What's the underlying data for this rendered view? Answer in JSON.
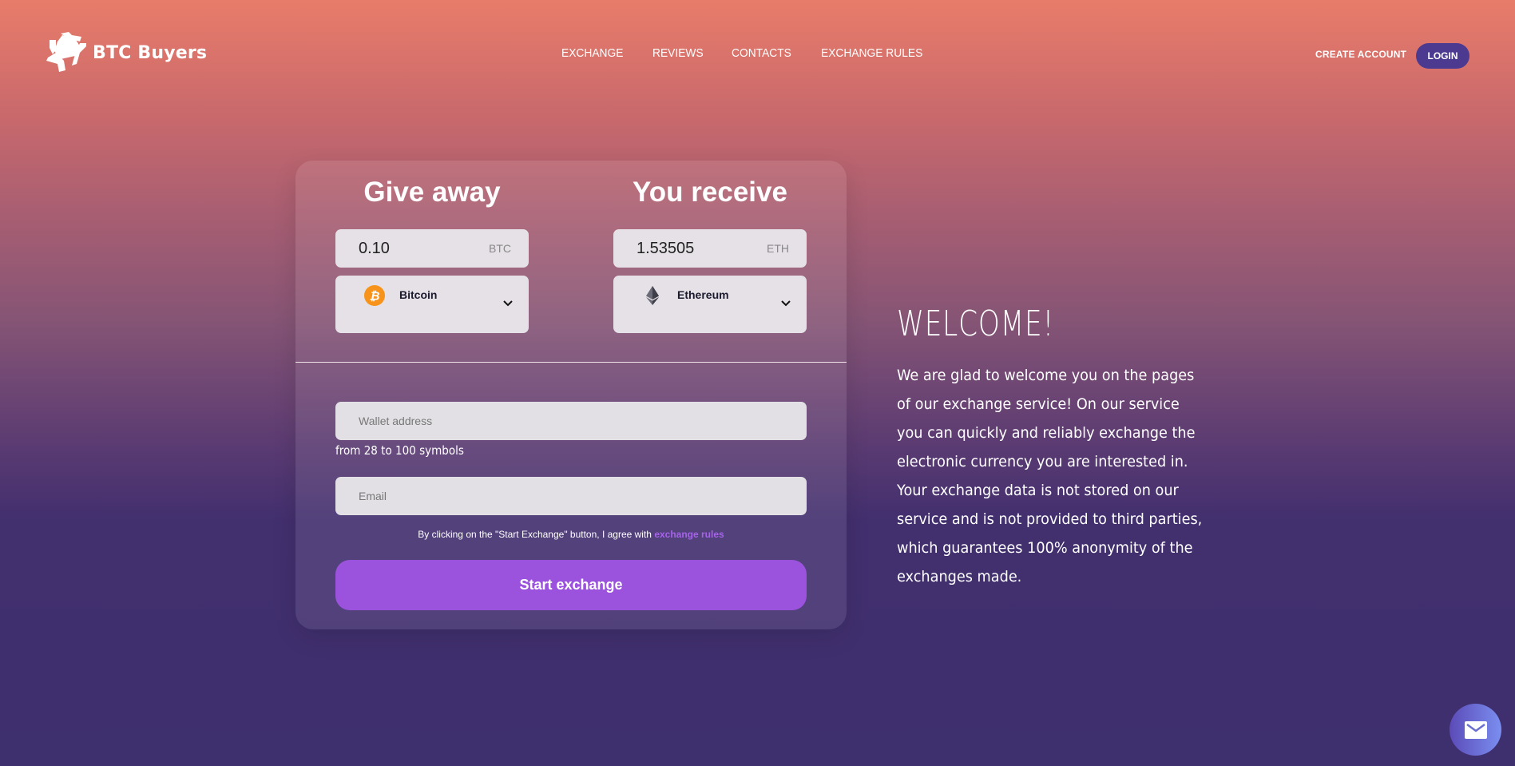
{
  "header": {
    "brand": "BTC Buyers",
    "logo_icon": "shutter-logo-icon",
    "nav": [
      {
        "label": "EXCHANGE"
      },
      {
        "label": "REVIEWS"
      },
      {
        "label": "CONTACTS"
      },
      {
        "label": "EXCHANGE RULES"
      }
    ],
    "create_account_label": "CREATE ACCOUNT",
    "login_label": "LOGIN"
  },
  "exchange_form": {
    "give": {
      "title": "Give away",
      "amount": "0.10",
      "unit": "BTC",
      "currency": "Bitcoin",
      "currency_icon": "bitcoin-icon"
    },
    "receive": {
      "title": "You receive",
      "amount": "1.53505",
      "unit": "ETH",
      "currency": "Ethereum",
      "currency_icon": "ethereum-icon"
    },
    "wallet_placeholder": "Wallet address",
    "wallet_hint": "from 28 to 100 symbols",
    "email_placeholder": "Email",
    "agree_text": "By clicking on the \"Start Exchange\" button, I agree with ",
    "agree_link": "exchange rules",
    "submit_label": "Start exchange"
  },
  "welcome": {
    "title": "WELCOME!",
    "text": "We are glad to welcome you on the pages of our exchange service! On our service you can quickly and reliably exchange the electronic currency you are interested in. Your exchange data is not stored on our service and is not provided to third parties, which guarantees 100% anonymity of the exchanges made."
  },
  "contact_button_icon": "mail-icon",
  "colors": {
    "accent": "#9b53de",
    "login_bg": "#4c3a91",
    "link": "#a663ea",
    "bitcoin": "#f7931a",
    "gradient_top": "#e87c6a",
    "gradient_bottom": "#3e2f6e"
  }
}
